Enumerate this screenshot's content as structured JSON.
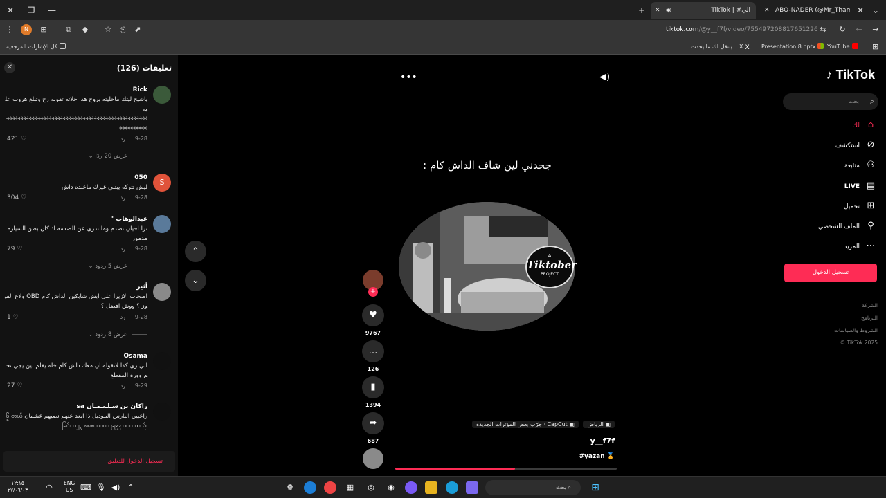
{
  "browser": {
    "tabs": [
      {
        "label": "TikTok | #الي"
      },
      {
        "label": "ABO-NADER (@Mr_Thamer109"
      }
    ],
    "url_host": "tiktok.com",
    "url_path": "/@y__f7f/video/7554972088176512263",
    "bookmarks_folder": "كل الإشارات المرجعية",
    "bookmarks": [
      {
        "label": "YouTube"
      },
      {
        "label": "Presentation 8.pptx"
      },
      {
        "label": "يتنقل لك ما يحدث... X"
      }
    ]
  },
  "comments_panel": {
    "title": "تعليقات (126)",
    "reply_label": "رد",
    "items": [
      {
        "name": "Rick",
        "text": "ياشيخ ليتك ماخليته بروح هذا حلاته تقوله رح وتبلغ هروب عليه",
        "extra": "ᢀᢀᢀᢀᢀᢀᢀᢀᢀᢀᢀᢀᢀᢀᢀᢀᢀᢀᢀᢀᢀᢀᢀᢀᢀᢀᢀᢀᢀᢀᢀᢀᢀᢀᢀᢀᢀᢀᢀᢀᢀᢀᢀᢀᢀᢀᢀᢀᢀᢀᢀᢀᢀᢀᢀᢀᢀᢀᢀᢀ",
        "date": "9-28",
        "likes": "421",
        "show": "عرض 20 ردًا"
      },
      {
        "name": "050",
        "text": "ليش تتركه يبتلي غيرك ماعنده داش",
        "date": "9-28",
        "likes": "304",
        "show": ""
      },
      {
        "name": "عبدالوهاب \"",
        "text": "ترا احيان تصدم وما تدري عن الصدمه اذ كان بطن السياره مدمور",
        "date": "9-28",
        "likes": "79",
        "show": "عرض 5 ردود"
      },
      {
        "name": "أثير",
        "text": "اصحاب الازيرا على ابش شابكين الداش كام OBD ولاع الفيوز ؟ ووش افضل ؟",
        "date": "9-28",
        "likes": "1",
        "show": "عرض 8 ردود"
      },
      {
        "name": "Osama",
        "text": "الي زي كذا لاتقوله ان معك داش كام خله يفلم لين يجي نجم ووره المقطع",
        "date": "9-29",
        "likes": "27",
        "show": ""
      },
      {
        "name": "راكان بن سـلـيـمـان sa",
        "text": "راعيين البارس الموديل ذا ابعد عنهم نصيهم غشمان ၆ၟ တယ်ခြင်း ၁၂၃ ၈၈၈ ၀၀၀ ၊ ၉၉၉ ၁၀၀ ထည်း",
        "date": "",
        "likes": "",
        "show": ""
      }
    ],
    "login_prompt": "تسجيل الدخول للتعليق"
  },
  "video": {
    "caption": "جحدني لين شاف الداش كام :",
    "badge_top": "A",
    "badge_main": "Tiktober",
    "badge_bottom": "PROJECT",
    "likes": "9767",
    "comments": "126",
    "saves": "1394",
    "shares": "687",
    "location": "الرياض",
    "capcut": "CapCut · جرّب بعض المؤثرات الجديدة",
    "author": "y__f7f",
    "hashtag": "#yazan",
    "progress": 0.54
  },
  "sidebar": {
    "logo": "TikTok",
    "search_placeholder": "بحث",
    "nav": [
      {
        "label": "لك",
        "icon": "home-icon"
      },
      {
        "label": "استكشف",
        "icon": "compass-icon"
      },
      {
        "label": "متابعة",
        "icon": "following-icon"
      },
      {
        "label": "LIVE",
        "icon": "live-icon"
      },
      {
        "label": "تحميل",
        "icon": "upload-icon"
      },
      {
        "label": "الملف الشخصي",
        "icon": "profile-icon"
      },
      {
        "label": "المزيد",
        "icon": "more-icon"
      }
    ],
    "login_button": "تسجيل الدخول",
    "footer": [
      "الشركة",
      "البرنامج",
      "الشروط والسياسات",
      "TikTok 2025 ©"
    ]
  },
  "taskbar": {
    "search_placeholder": "بحث",
    "language": "ENG",
    "region": "US",
    "time": "١٢:١٥",
    "date": "٢٧/٠٦/٠٣"
  },
  "colors": {
    "accent": "#fe2c55",
    "background": "#000000",
    "panel": "#121212"
  }
}
